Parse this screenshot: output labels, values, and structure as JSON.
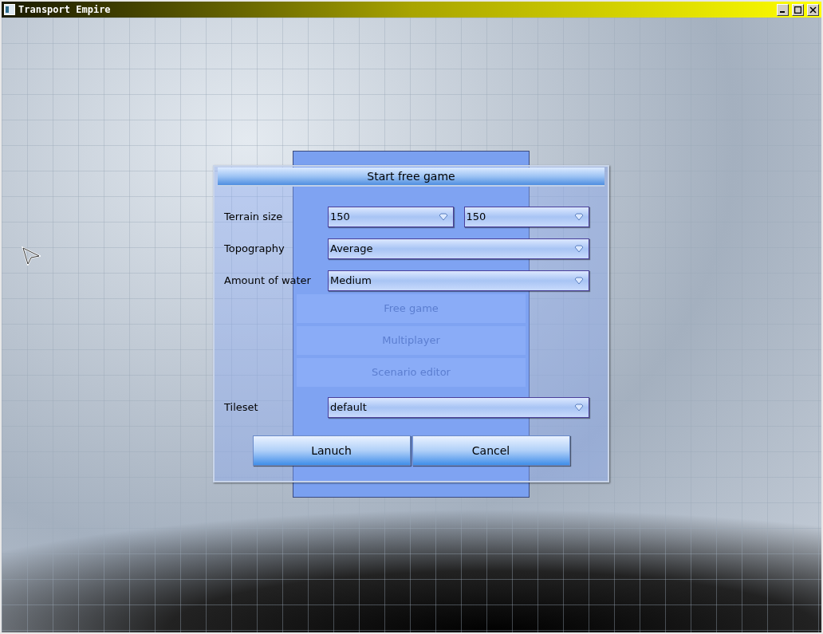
{
  "window": {
    "title": "Transport Empire"
  },
  "background_menu": {
    "items": [
      "Free game",
      "Multiplayer",
      "Scenario editor"
    ]
  },
  "dialog": {
    "title": "Start free game",
    "rows": [
      {
        "label": "Terrain size",
        "selects": [
          "150",
          "150"
        ]
      },
      {
        "label": "Topography",
        "selects": [
          "Average"
        ]
      },
      {
        "label": "Amount of water",
        "selects": [
          "Medium"
        ]
      }
    ],
    "tileset": {
      "label": "Tileset",
      "selects": [
        "default"
      ]
    },
    "buttons": [
      "Lanuch",
      "Cancel"
    ]
  }
}
